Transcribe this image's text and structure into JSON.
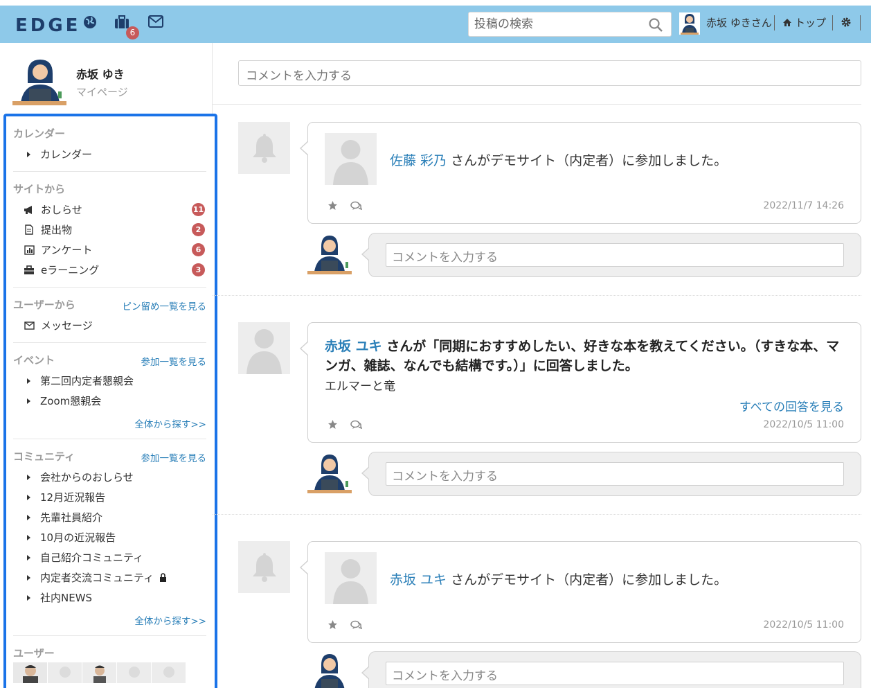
{
  "header": {
    "logo": "EDGE",
    "notification_count": "6",
    "search_placeholder": "投稿の検索",
    "user_label": "赤坂 ゆきさん",
    "top_label": "トップ"
  },
  "profile": {
    "name": "赤坂 ゆき",
    "mypage": "マイページ"
  },
  "sidebar": {
    "calendar": {
      "title": "カレンダー",
      "items": [
        "カレンダー"
      ]
    },
    "site": {
      "title": "サイトから",
      "items": [
        {
          "label": "おしらせ",
          "icon": "megaphone-icon",
          "count": "11"
        },
        {
          "label": "提出物",
          "icon": "document-icon",
          "count": "2"
        },
        {
          "label": "アンケート",
          "icon": "bar-chart-icon",
          "count": "6"
        },
        {
          "label": "eラーニング",
          "icon": "briefcase-icon",
          "count": "3"
        }
      ]
    },
    "user": {
      "title": "ユーザーから",
      "link": "ピン留め一覧を見る",
      "items": [
        "メッセージ"
      ]
    },
    "event": {
      "title": "イベント",
      "link": "参加一覧を見る",
      "items": [
        "第二回内定者懇親会",
        "Zoom懇親会"
      ],
      "more": "全体から探す>>"
    },
    "community": {
      "title": "コミュニティ",
      "link": "参加一覧を見る",
      "items": [
        "会社からのおしらせ",
        "12月近況報告",
        "先輩社員紹介",
        "10月の近況報告",
        "自己紹介コミュニティ",
        "内定者交流コミュニティ",
        "社内NEWS"
      ],
      "more": "全体から探す>>"
    },
    "users": {
      "title": "ユーザー"
    }
  },
  "main": {
    "comment_placeholder": "コメントを入力する",
    "posts": [
      {
        "name": "佐藤 彩乃",
        "text": " さんがデモサイト（内定者）に参加しました。",
        "date": "2022/11/7 14:26"
      },
      {
        "name": "赤坂 ユキ",
        "text": " さんが「同期におすすめしたい、好きな本を教えてください。（すきな本、マンガ、雑誌、なんでも結構です。）」に回答しました。",
        "answer": "エルマーと竜",
        "all_answers": "すべての回答を見る",
        "date": "2022/10/5 11:00"
      },
      {
        "name": "赤坂 ユキ",
        "text": " さんがデモサイト（内定者）に参加しました。",
        "date": "2022/10/5 11:00"
      }
    ]
  }
}
